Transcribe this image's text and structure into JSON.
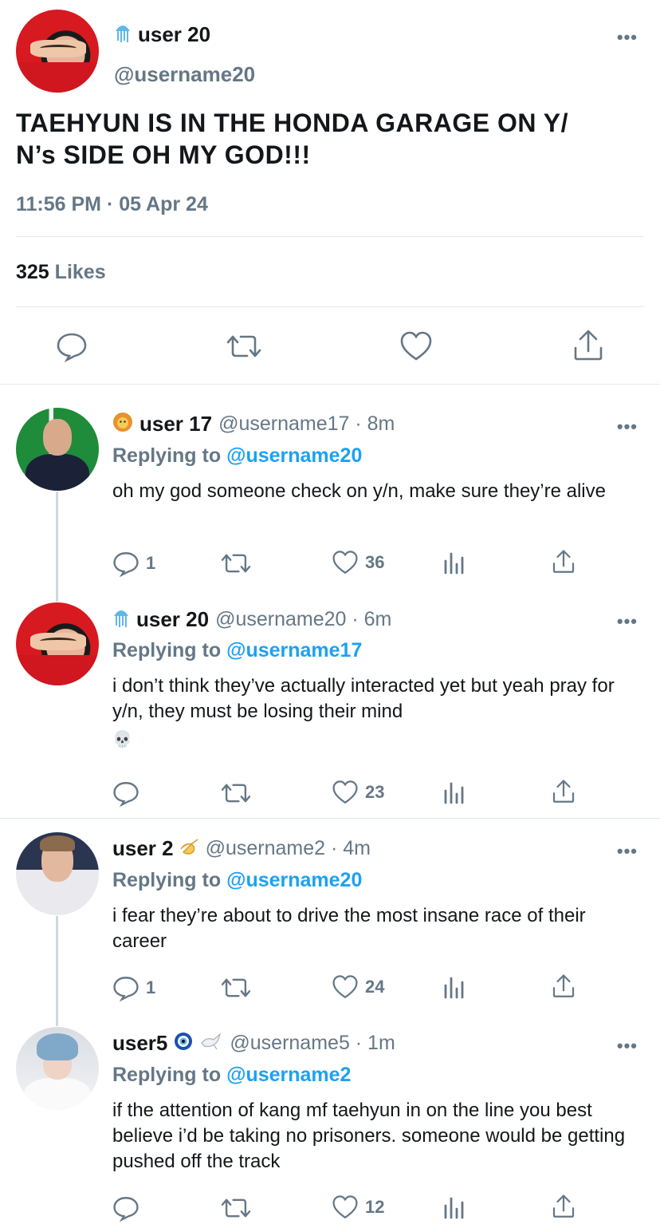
{
  "main_tweet": {
    "display_name": "user 20",
    "handle": "@username20",
    "text": "TAEHYUN IS IN THE HONDA GARAGE ON Y/\nN’s SIDE OH MY GOD!!!",
    "timestamp": "11:56 PM · 05 Apr 24",
    "likes_count": "325",
    "likes_label": "Likes",
    "more": "•••"
  },
  "replies": [
    {
      "display_name": "user 17",
      "handle_meta": "@username17 · 8m",
      "replying_label": "Replying to",
      "replying_to": "@username20",
      "text": "oh my god someone check on y/n, make sure they’re alive",
      "reply_count": "1",
      "like_count": "36",
      "more": "•••"
    },
    {
      "display_name": "user 20",
      "handle_meta": "@username20 · 6m",
      "replying_label": "Replying to",
      "replying_to": "@username17",
      "text": "i don’t think they’ve actually interacted yet but yeah pray for y/n, they must be losing their mind",
      "emoji": "💀",
      "reply_count": "",
      "like_count": "23",
      "more": "•••"
    },
    {
      "display_name": "user 2",
      "handle_meta": "@username2 · 4m",
      "replying_label": "Replying to",
      "replying_to": "@username20",
      "text": "i fear they’re about to drive the most insane race of their career",
      "reply_count": "1",
      "like_count": "24",
      "more": "•••"
    },
    {
      "display_name": "user5",
      "handle_meta": "@username5 · 1m",
      "replying_label": "Replying to",
      "replying_to": "@username2",
      "text": "if the attention of kang mf taehyun in on the line you best believe i’d be taking no prisoners. someone would be getting pushed off the track",
      "reply_count": "",
      "like_count": "12",
      "more": "•••"
    }
  ],
  "colors": {
    "text": "#14171a",
    "muted": "#657786",
    "link": "#1da1f2",
    "divider": "#e1e8ed"
  },
  "icons": {
    "main_badge": "jellyfish-icon",
    "reply1_badge": "lion-icon",
    "reply3_badge": "pinching-hand-icon",
    "reply4_badges": [
      "nazar-amulet-icon",
      "dove-icon"
    ]
  }
}
